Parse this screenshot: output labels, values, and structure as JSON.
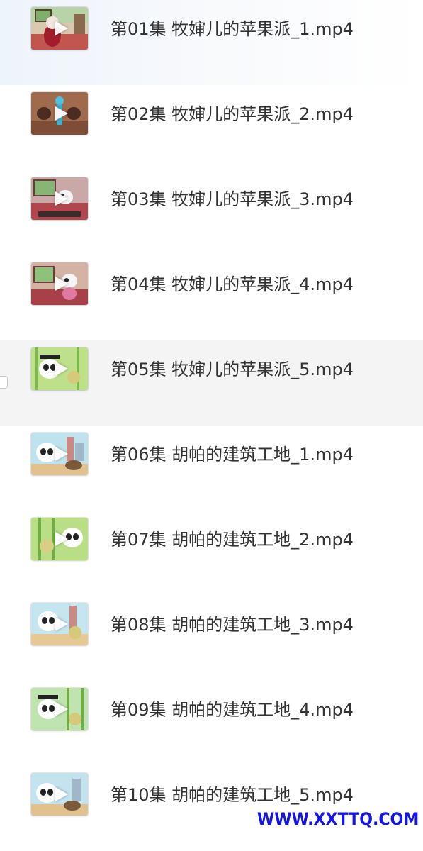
{
  "files": [
    {
      "name": "第01集 牧婶儿的苹果派_1.mp4",
      "thumb": "kitchen-red"
    },
    {
      "name": "第02集 牧婶儿的苹果派_2.mp4",
      "thumb": "brown-birds"
    },
    {
      "name": "第03集 牧婶儿的苹果派_3.mp4",
      "thumb": "kitchen-cow"
    },
    {
      "name": "第04集 牧婶儿的苹果派_4.mp4",
      "thumb": "kitchen-cow-2"
    },
    {
      "name": "第05集 牧婶儿的苹果派_5.mp4",
      "thumb": "bamboo-panda",
      "hovered": true
    },
    {
      "name": "第06集 胡帕的建筑工地_1.mp4",
      "thumb": "city-panda"
    },
    {
      "name": "第07集 胡帕的建筑工地_2.mp4",
      "thumb": "bamboo-turtle"
    },
    {
      "name": "第08集 胡帕的建筑工地_3.mp4",
      "thumb": "city-panda-2"
    },
    {
      "name": "第09集 胡帕的建筑工地_4.mp4",
      "thumb": "bamboo-panda-2"
    },
    {
      "name": "第10集 胡帕的建筑工地_5.mp4",
      "thumb": "city-panda-3"
    }
  ],
  "watermark": "WWW.XXTTQ.COM",
  "icons": {
    "play": "play-icon",
    "checkbox": "checkbox-icon"
  },
  "colors": {
    "text": "#333333",
    "hover_row": "#f4f4f4",
    "watermark": "#1414e6"
  }
}
